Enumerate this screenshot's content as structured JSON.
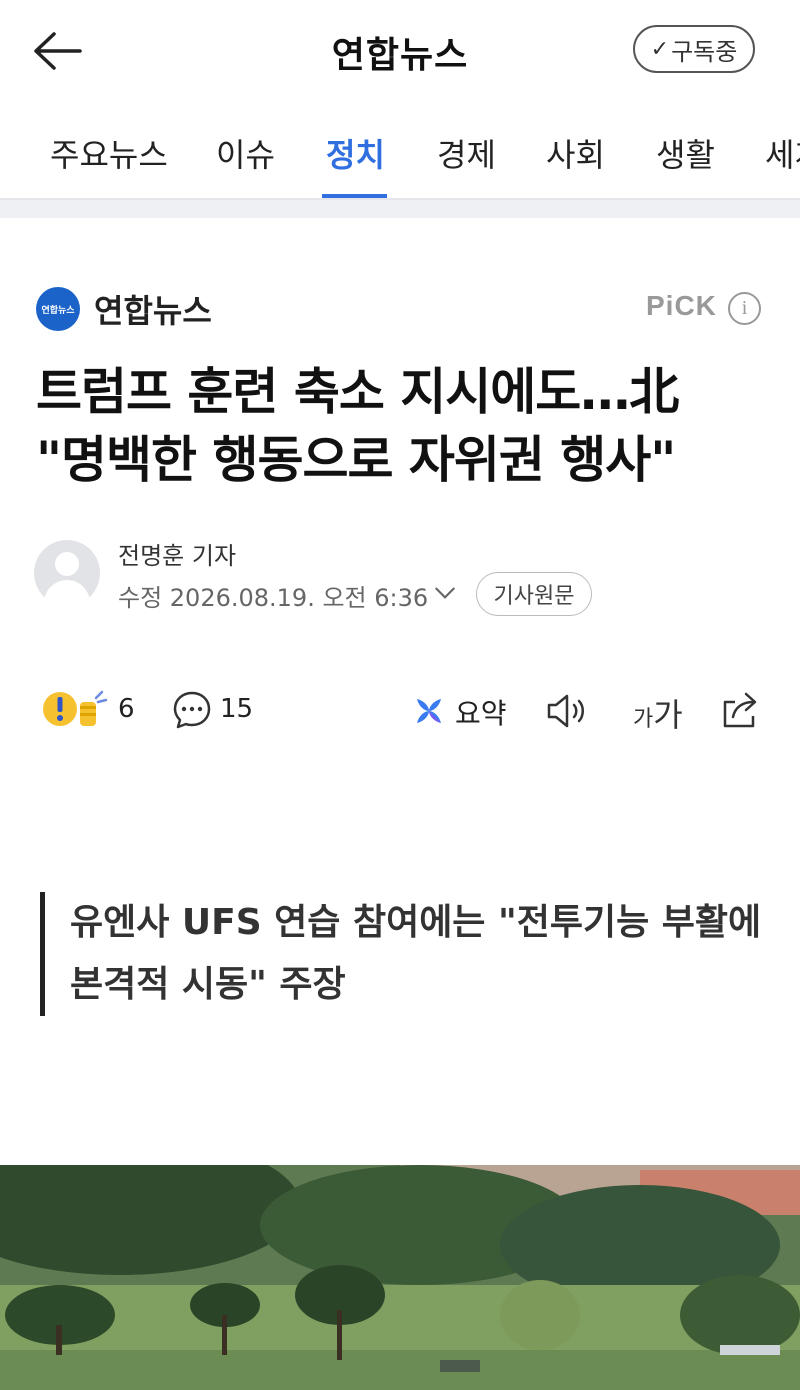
{
  "header": {
    "title": "연합뉴스",
    "subscribe_label": "구독중",
    "subscribe_check": "✓"
  },
  "tabs": [
    {
      "label": "주요뉴스"
    },
    {
      "label": "이슈"
    },
    {
      "label": "정치",
      "active": true
    },
    {
      "label": "경제"
    },
    {
      "label": "사회"
    },
    {
      "label": "생활"
    },
    {
      "label": "세계"
    }
  ],
  "publisher": {
    "logo_text": "연합뉴스",
    "name": "연합뉴스",
    "badge": "PiCK",
    "info_glyph": "i"
  },
  "article": {
    "headline_line1": "트럼프 훈련 축소 지시에도…北",
    "headline_line2": "\"명백한 행동으로 자위권 행사\"",
    "reporter": "전명훈 기자",
    "edit_time": "수정 2026.08.19. 오전 6:36",
    "original_label": "기사원문",
    "subheading_line1": "유엔사 UFS 연습 참여에는 \"전투기능 부활에",
    "subheading_line2": "본격적 시동\" 주장"
  },
  "actions": {
    "reaction_count": "6",
    "comment_count": "15",
    "summary_label": "요약",
    "font_size_small": "가",
    "font_size_large": "가"
  },
  "colors": {
    "accent": "#2f6fe0",
    "publisher_logo": "#1c63c9"
  },
  "icons": [
    "back-arrow-icon",
    "check-icon",
    "info-icon",
    "reaction-icon",
    "comment-icon",
    "summary-icon",
    "speaker-icon",
    "share-icon"
  ]
}
